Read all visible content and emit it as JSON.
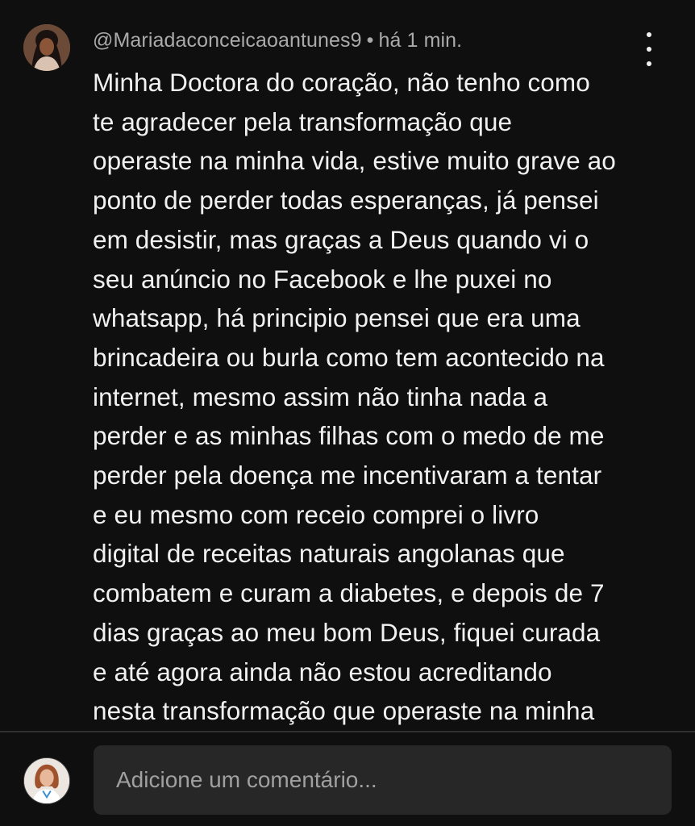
{
  "comment": {
    "author": "@Mariadaconceicaoantunes9",
    "separator": "•",
    "time": "há 1 min.",
    "avatar_icon": "user-avatar-photo",
    "more_icon": "more-vertical-icon",
    "text_lines": [
      "Minha Doctora do coração, não tenho como",
      "te agradecer pela transformação que",
      "operaste na minha vida, estive muito grave ao",
      "ponto de perder todas esperanças, já pensei",
      "em desistir, mas graças a Deus quando vi o",
      "seu anúncio no Facebook e lhe puxei no",
      "whatsapp, há principio pensei que era uma",
      "brincadeira ou burla como tem acontecido na",
      "internet, mesmo assim não tinha nada a",
      "perder e as minhas filhas com o medo de me",
      "perder pela doença me incentivaram a tentar",
      "e eu mesmo com receio comprei o livro",
      "digital de receitas naturais angolanas que",
      "combatem e curam a diabetes, e depois de 7",
      "dias graças ao meu bom Deus, fiquei curada",
      "e até agora ainda não estou acreditando",
      "nesta transformação que operaste na minha"
    ]
  },
  "composer": {
    "avatar_icon": "current-user-avatar-photo",
    "placeholder": "Adicione um comentário..."
  },
  "colors": {
    "background": "#0f0f0f",
    "text_primary": "#f1f1f1",
    "text_secondary": "#aaaaaa",
    "input_background": "#272727",
    "divider": "#303030"
  }
}
